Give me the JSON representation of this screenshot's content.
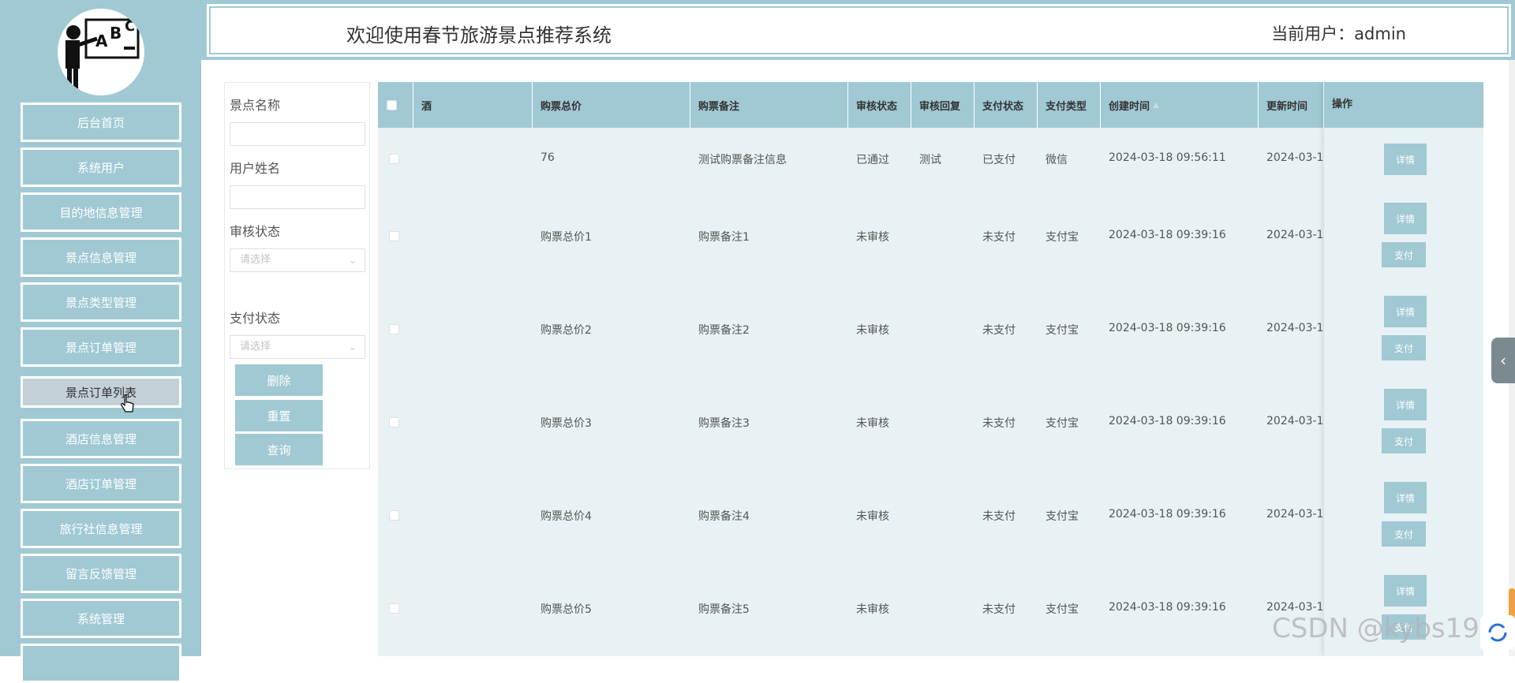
{
  "header": {
    "title": "欢迎使用春节旅游景点推荐系统",
    "user": "当前用户：admin"
  },
  "sidebar": {
    "items": [
      {
        "label": "后台首页"
      },
      {
        "label": "系统用户"
      },
      {
        "label": "目的地信息管理"
      },
      {
        "label": "景点信息管理"
      },
      {
        "label": "景点类型管理"
      },
      {
        "label": "景点订单管理"
      },
      {
        "label": "景点订单列表"
      },
      {
        "label": "酒店信息管理"
      },
      {
        "label": "酒店订单管理"
      },
      {
        "label": "旅行社信息管理"
      },
      {
        "label": "留言反馈管理"
      },
      {
        "label": "系统管理"
      }
    ]
  },
  "filter": {
    "spot_name_label": "景点名称",
    "user_name_label": "用户姓名",
    "audit_label": "审核状态",
    "audit_placeholder": "请选择",
    "pay_label": "支付状态",
    "pay_placeholder": "请选择",
    "delete_label": "删除",
    "reset_label": "重置",
    "query_label": "查询"
  },
  "table": {
    "headers": {
      "partial": "酒",
      "total_price": "购票总价",
      "remark": "购票备注",
      "audit_status": "审核状态",
      "audit_reply": "审核回复",
      "pay_status": "支付状态",
      "pay_type": "支付类型",
      "created": "创建时间",
      "updated": "更新时间",
      "action": "操作"
    },
    "rows": [
      {
        "total_price": "76",
        "remark": "测试购票备注信息",
        "audit_status": "已通过",
        "audit_reply": "测试",
        "pay_status": "已支付",
        "pay_type": "微信",
        "created": "2024-03-18 09:56:11",
        "updated": "2024-03-1",
        "detail": "详情",
        "pay": ""
      },
      {
        "total_price": "购票总价1",
        "remark": "购票备注1",
        "audit_status": "未审核",
        "audit_reply": "",
        "pay_status": "未支付",
        "pay_type": "支付宝",
        "created": "2024-03-18 09:39:16",
        "updated": "2024-03-1",
        "detail": "详情",
        "pay": "支付"
      },
      {
        "total_price": "购票总价2",
        "remark": "购票备注2",
        "audit_status": "未审核",
        "audit_reply": "",
        "pay_status": "未支付",
        "pay_type": "支付宝",
        "created": "2024-03-18 09:39:16",
        "updated": "2024-03-1",
        "detail": "详情",
        "pay": "支付"
      },
      {
        "total_price": "购票总价3",
        "remark": "购票备注3",
        "audit_status": "未审核",
        "audit_reply": "",
        "pay_status": "未支付",
        "pay_type": "支付宝",
        "created": "2024-03-18 09:39:16",
        "updated": "2024-03-1",
        "detail": "详情",
        "pay": "支付"
      },
      {
        "total_price": "购票总价4",
        "remark": "购票备注4",
        "audit_status": "未审核",
        "audit_reply": "",
        "pay_status": "未支付",
        "pay_type": "支付宝",
        "created": "2024-03-18 09:39:16",
        "updated": "2024-03-1",
        "detail": "详情",
        "pay": "支付"
      },
      {
        "total_price": "购票总价5",
        "remark": "购票备注5",
        "audit_status": "未审核",
        "audit_reply": "",
        "pay_status": "未支付",
        "pay_type": "支付宝",
        "created": "2024-03-18 09:39:16",
        "updated": "2024-03-1",
        "detail": "详情",
        "pay": "支付"
      }
    ]
  },
  "watermark": "CSDN @kybs1991"
}
